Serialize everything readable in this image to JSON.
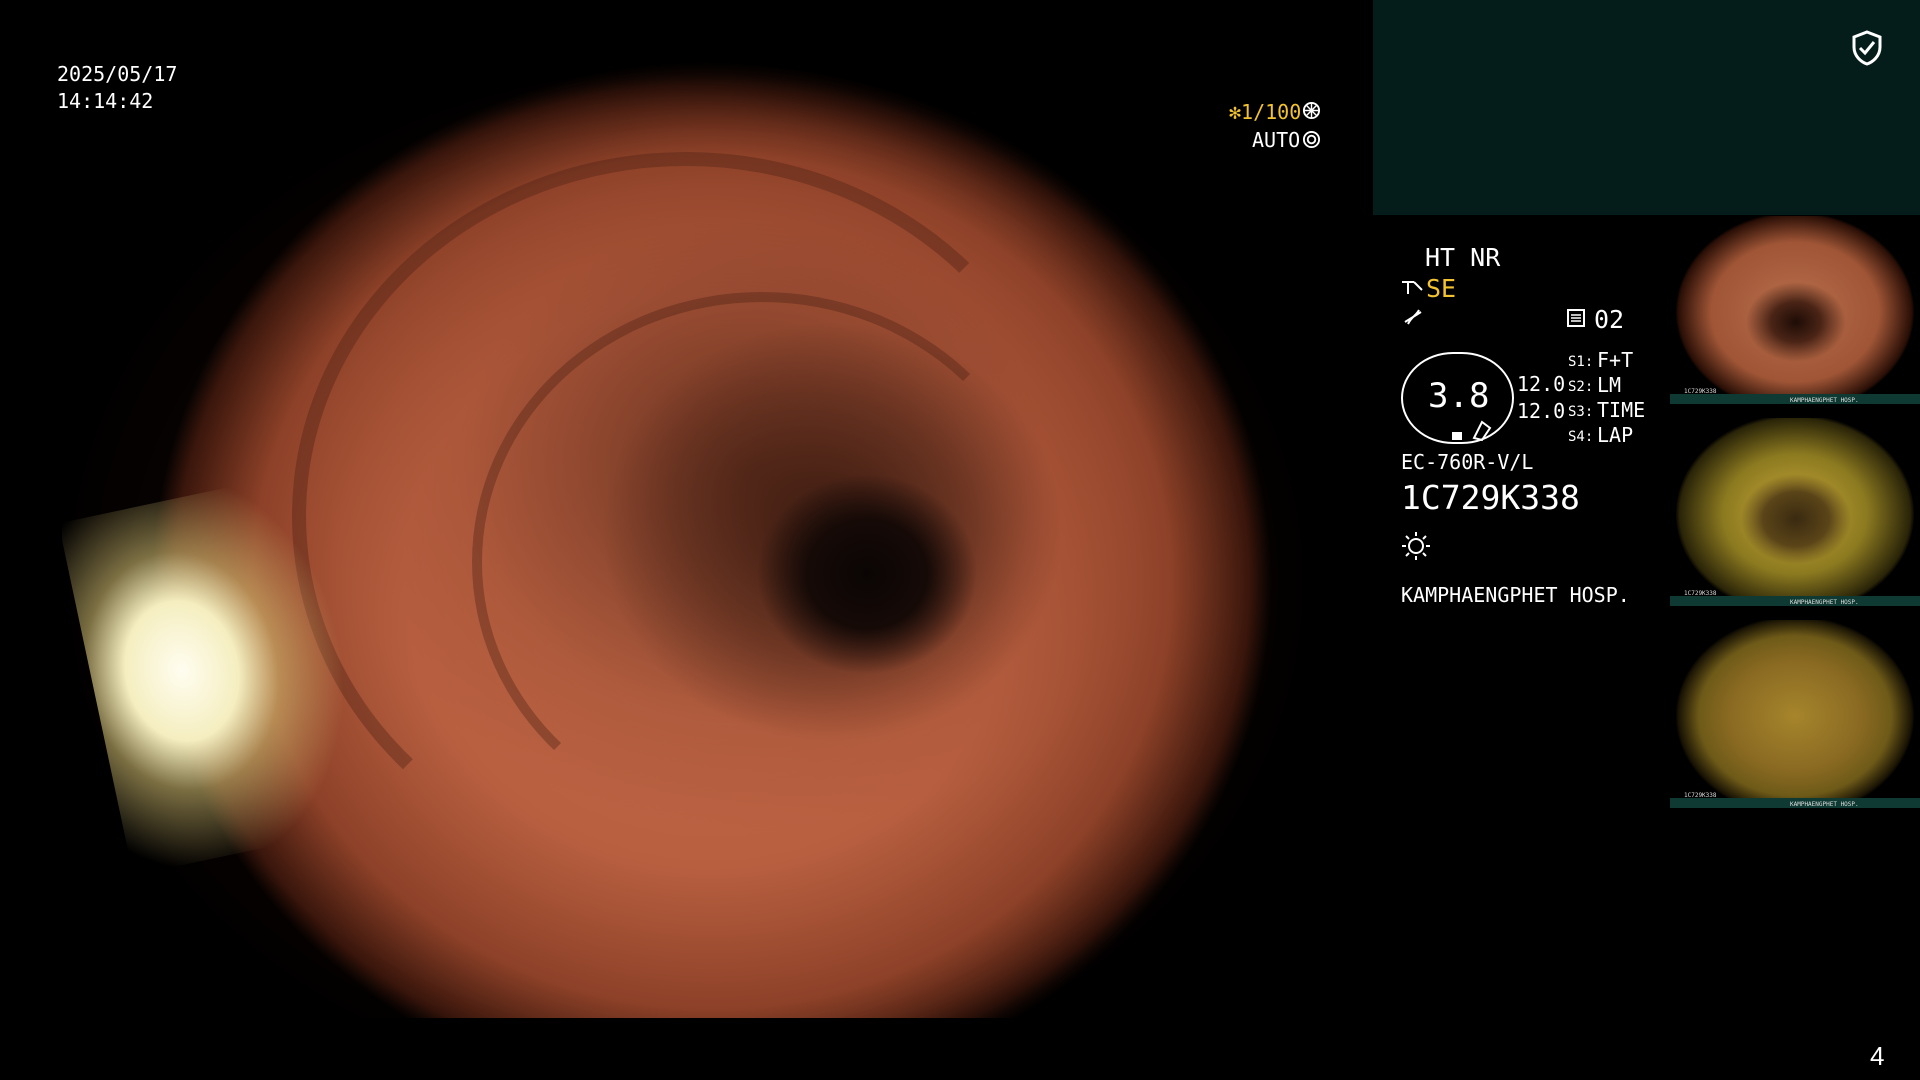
{
  "osd": {
    "date": "2025/05/17",
    "time": "14:14:42",
    "shutter": "✻1/100",
    "iris": "AUTO",
    "shutter_icon": "shutter-icon",
    "iris_icon": "iris-icon",
    "page_number": "4"
  },
  "panel": {
    "shield_icon": "shield-check-icon",
    "mode": "HT NR",
    "enhance": "SE",
    "image_count": "02",
    "zoom_value": "3.8",
    "value_a": "12.0",
    "value_b": "12.0",
    "s1": "F+T",
    "s2": "LM",
    "s3": "TIME",
    "s4": "LAP",
    "s1_label": "S1:",
    "s2_label": "S2:",
    "s3_label": "S3:",
    "s4_label": "S4:",
    "scope_model": "EC-760R-V/L",
    "serial": "1C729K338",
    "light_icon": "sun-icon",
    "hospital": "KAMPHAENGPHET HOSP."
  },
  "thumbnails": [
    {
      "serial": "1C729K338",
      "caption": "KAMPHAENGPHET HOSP."
    },
    {
      "serial": "1C729K338",
      "caption": "KAMPHAENGPHET HOSP."
    },
    {
      "serial": "1C729K338",
      "caption": "KAMPHAENGPHET HOSP."
    }
  ],
  "colors": {
    "background": "#000000",
    "panel_teal": "#041d1a",
    "highlight_yellow": "#f2c230",
    "mucosa": "#c56e4c"
  }
}
